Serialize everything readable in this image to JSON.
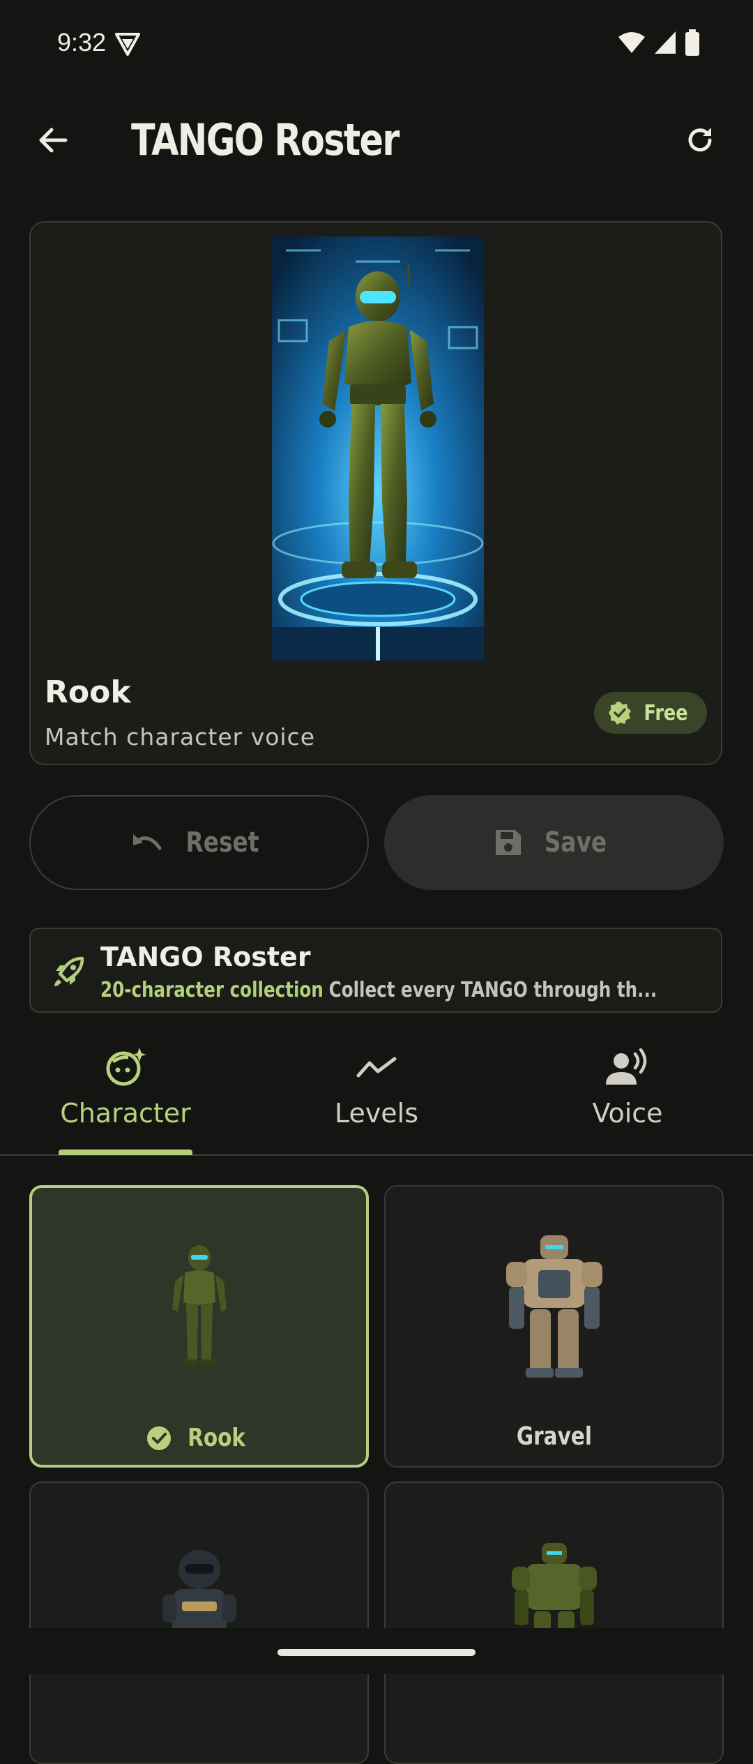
{
  "status_bar": {
    "time": "9:32"
  },
  "app_bar": {
    "title": "TANGO Roster",
    "back_icon": "arrow-left-icon",
    "refresh_icon": "refresh-icon"
  },
  "hero": {
    "name": "Rook",
    "subtitle": "Match character voice",
    "badge": "Free"
  },
  "actions": {
    "reset_label": "Reset",
    "save_label": "Save"
  },
  "banner": {
    "title": "TANGO Roster",
    "highlight": "20-character collection",
    "description": "Collect every TANGO through th..."
  },
  "tabs": [
    {
      "label": "Character",
      "icon": "character-face-icon",
      "active": true
    },
    {
      "label": "Levels",
      "icon": "trend-line-icon",
      "active": false
    },
    {
      "label": "Voice",
      "icon": "voice-person-icon",
      "active": false
    }
  ],
  "characters": [
    {
      "name": "Rook",
      "selected": true
    },
    {
      "name": "Gravel",
      "selected": false
    },
    {
      "name": "",
      "selected": false
    },
    {
      "name": "",
      "selected": false
    }
  ],
  "colors": {
    "accent": "#b4ce81",
    "background": "#141413",
    "card": "#1c1d1a"
  }
}
